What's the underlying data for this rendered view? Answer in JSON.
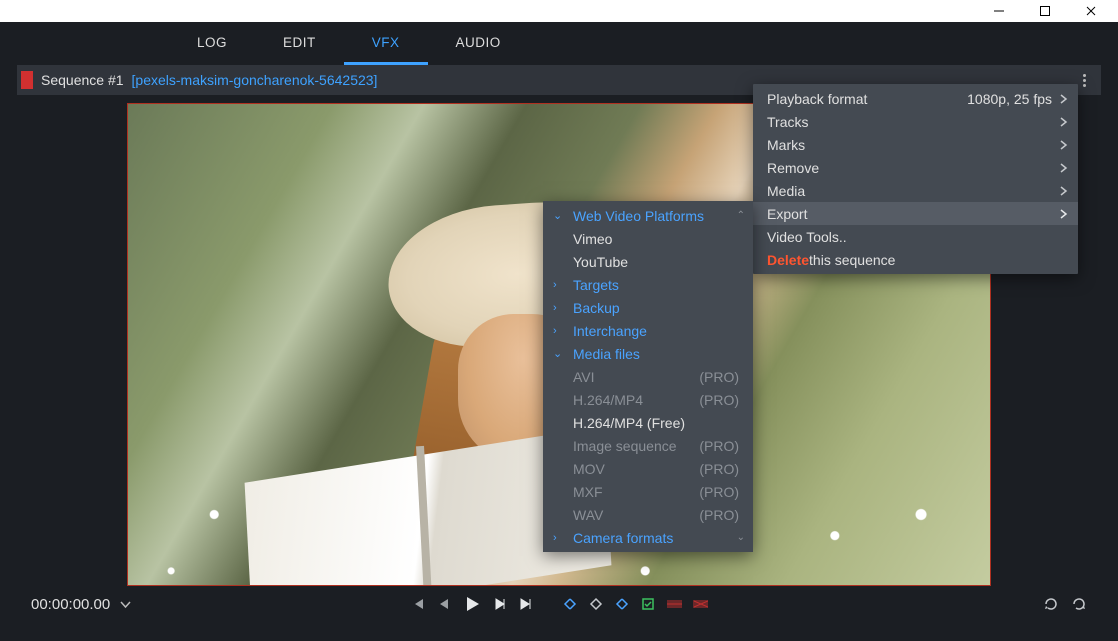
{
  "menubar": {
    "tabs": [
      {
        "label": "LOG"
      },
      {
        "label": "EDIT"
      },
      {
        "label": "VFX"
      },
      {
        "label": "AUDIO"
      }
    ]
  },
  "sequence": {
    "name": "Sequence #1",
    "clip": "[pexels-maksim-goncharenok-5642523]"
  },
  "transport": {
    "timecode": "00:00:00.00"
  },
  "context_menu": {
    "items": [
      {
        "label": "Playback format",
        "value": "1080p, 25 fps",
        "chevron": true
      },
      {
        "label": "Tracks",
        "chevron": true
      },
      {
        "label": "Marks",
        "chevron": true
      },
      {
        "label": "Remove",
        "chevron": true
      },
      {
        "label": "Media",
        "chevron": true
      },
      {
        "label": "Export",
        "chevron": true,
        "highlight": true
      },
      {
        "label": "Video Tools.."
      },
      {
        "delete_label": "Delete",
        "rest_label": " this sequence",
        "danger": true
      }
    ]
  },
  "export_submenu": {
    "sections": [
      {
        "label": "Web Video Platforms",
        "state": "open",
        "items": [
          {
            "label": "Vimeo"
          },
          {
            "label": "YouTube"
          }
        ]
      },
      {
        "label": "Targets",
        "state": "closed"
      },
      {
        "label": "Backup",
        "state": "closed"
      },
      {
        "label": "Interchange",
        "state": "closed"
      },
      {
        "label": "Media files",
        "state": "open",
        "items": [
          {
            "label": "AVI",
            "badge": "(PRO)",
            "disabled": true
          },
          {
            "label": "H.264/MP4",
            "badge": "(PRO)",
            "disabled": true
          },
          {
            "label": "H.264/MP4 (Free)"
          },
          {
            "label": "Image sequence",
            "badge": "(PRO)",
            "disabled": true
          },
          {
            "label": "MOV",
            "badge": "(PRO)",
            "disabled": true
          },
          {
            "label": "MXF",
            "badge": "(PRO)",
            "disabled": true
          },
          {
            "label": "WAV",
            "badge": "(PRO)",
            "disabled": true
          }
        ]
      },
      {
        "label": "Camera formats",
        "state": "closed"
      }
    ]
  }
}
